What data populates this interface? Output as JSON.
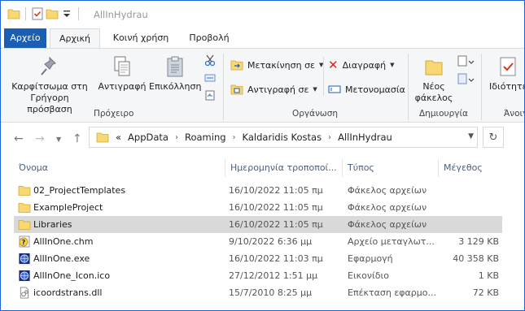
{
  "window": {
    "title": "AllInHydrau"
  },
  "tabs": {
    "file": "Αρχείο",
    "home": "Αρχική",
    "share": "Κοινή χρήση",
    "view": "Προβολή"
  },
  "ribbon": {
    "pin": "Καρφίτσωμα στη Γρήγορη πρόσβαση",
    "copy": "Αντιγραφή",
    "paste": "Επικόλληση",
    "clipboard_group": "Πρόχειρο",
    "move_to": "Μετακίνηση σε",
    "copy_to": "Αντιγραφή σε",
    "delete": "Διαγραφή",
    "rename": "Μετονομασία",
    "organize_group": "Οργάνωση",
    "new_folder": "Νέος φάκελος",
    "new_group": "Δημιουργία",
    "properties": "Ιδιότητες",
    "open_group": "Άνοιγμα"
  },
  "address": {
    "overflow": "«",
    "crumbs": [
      "AppData",
      "Roaming",
      "Kaldaridis Kostas",
      "AllInHydrau"
    ]
  },
  "columns": {
    "name": "Όνομα",
    "date": "Ημερομηνία τροποποί...",
    "type": "Τύπος",
    "size": "Μέγεθος"
  },
  "files": [
    {
      "name": "02_ProjectTemplates",
      "date": "16/10/2022 11:05 πμ",
      "type": "Φάκελος αρχείων",
      "size": "",
      "icon": "folder-icon"
    },
    {
      "name": "ExampleProject",
      "date": "16/10/2022 11:05 πμ",
      "type": "Φάκελος αρχείων",
      "size": "",
      "icon": "folder-icon"
    },
    {
      "name": "Libraries",
      "date": "16/10/2022 11:05 πμ",
      "type": "Φάκελος αρχείων",
      "size": "",
      "icon": "folder-icon"
    },
    {
      "name": "AllInOne.chm",
      "date": "9/10/2022 6:36 μμ",
      "type": "Αρχείο μεταγλωτ...",
      "size": "3 129 KB",
      "icon": "help-file-icon"
    },
    {
      "name": "AllInOne.exe",
      "date": "16/10/2022 11:03 πμ",
      "type": "Εφαρμογή",
      "size": "40 358 KB",
      "icon": "globe-app-icon"
    },
    {
      "name": "AllInOne_Icon.ico",
      "date": "27/12/2012 1:51 μμ",
      "type": "Εικονίδιο",
      "size": "1 KB",
      "icon": "globe-app-icon"
    },
    {
      "name": "icoordstrans.dll",
      "date": "15/7/2010 8:25 μμ",
      "type": "Επέκταση εφαρμο...",
      "size": "72 KB",
      "icon": "dll-file-icon"
    }
  ],
  "selected_index": 2,
  "colors": {
    "accent": "#1a5fb4",
    "folder": "#f8d775",
    "selection": "#d9d9d9"
  }
}
